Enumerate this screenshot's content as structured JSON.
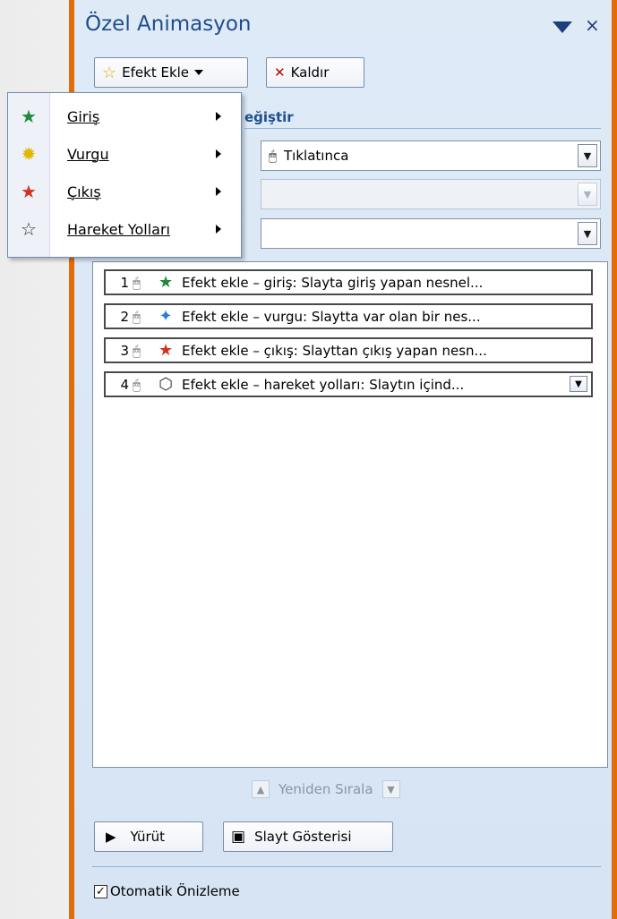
{
  "pane": {
    "title": "Özel Animasyon",
    "close_glyph": "×"
  },
  "toolbar": {
    "add_effect_label": "Efekt Ekle",
    "remove_label": "Kaldır"
  },
  "menu": {
    "items": [
      {
        "label": "Giriş",
        "icon": "entrance-star-icon"
      },
      {
        "label": "Vurgu",
        "icon": "emphasis-star-icon"
      },
      {
        "label": "Çıkış",
        "icon": "exit-star-icon"
      },
      {
        "label": "Hareket Yolları",
        "icon": "motion-path-star-icon"
      }
    ]
  },
  "change_section": {
    "label_visible": "eğiştir"
  },
  "fields": {
    "start_value": "Tıklatınca",
    "property_value": "",
    "speed_value": ""
  },
  "effects_list": [
    {
      "num": "1",
      "icon": "entrance-effect-icon",
      "text": "Efekt ekle – giriş: Slayta  giriş yapan nesnel..."
    },
    {
      "num": "2",
      "icon": "emphasis-effect-icon",
      "text": "Efekt ekle – vurgu: Slaytta  var olan bir nes..."
    },
    {
      "num": "3",
      "icon": "exit-effect-icon",
      "text": "Efekt ekle – çıkış: Slayttan çıkış yapan nesn..."
    },
    {
      "num": "4",
      "icon": "motion-path-effect-icon",
      "text": "Efekt ekle – hareket yolları: Slaytın içind..."
    }
  ],
  "reorder": {
    "label": "Yeniden Sırala"
  },
  "buttons": {
    "play": "Yürüt",
    "slideshow": "Slayt Gösterisi"
  },
  "auto_preview": {
    "label": "Otomatik Önizleme",
    "checked": true
  },
  "colors": {
    "accent_orange": "#e36c0a",
    "title_blue": "#1f4e8c",
    "pane_bg": "#dfeaf7"
  }
}
